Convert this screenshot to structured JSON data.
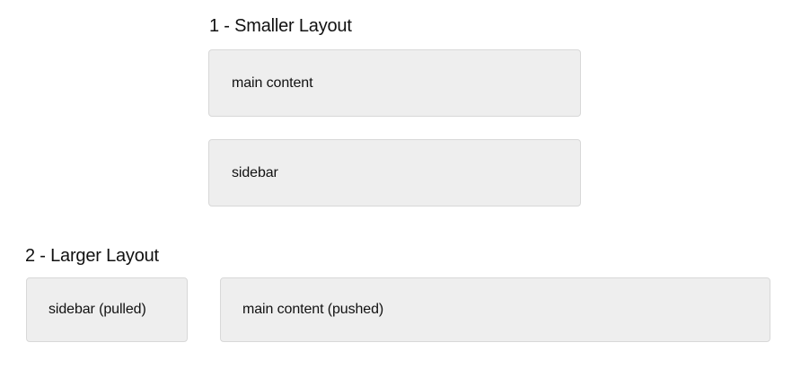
{
  "smaller_layout": {
    "heading": "1 - Smaller Layout",
    "main_content": "main content",
    "sidebar": "sidebar"
  },
  "larger_layout": {
    "heading": "2 - Larger Layout",
    "sidebar": "sidebar (pulled)",
    "main_content": "main content (pushed)"
  },
  "colors": {
    "box_background": "#eeeeee",
    "box_border": "#d8d8d8",
    "text": "#111111"
  }
}
